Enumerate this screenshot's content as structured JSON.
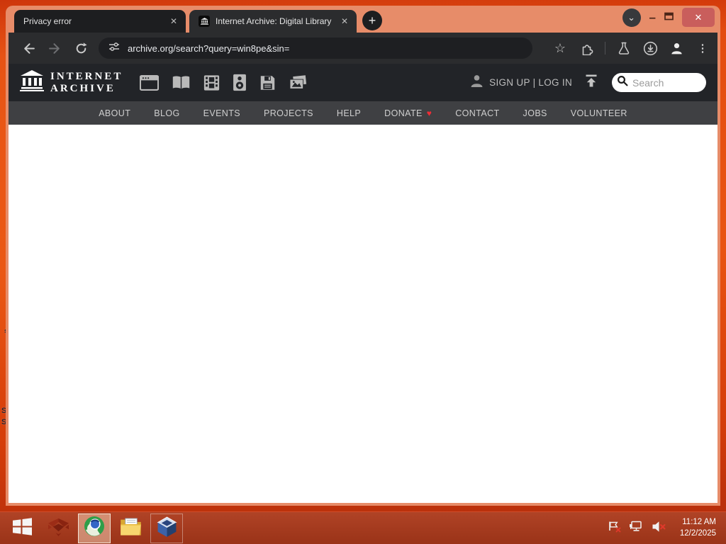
{
  "browser": {
    "tabs": [
      {
        "title": "Privacy error"
      },
      {
        "title": "Internet Archive: Digital Library"
      }
    ],
    "url": "archive.org/search?query=win8pe&sin="
  },
  "glyphs": {
    "close_x": "✕",
    "plus": "+",
    "chevron_down": "⌄",
    "minimize": "–",
    "kebab": "⋮",
    "star": "☆",
    "heart": "♥"
  },
  "ia": {
    "wordmark_line1": "INTERNET",
    "wordmark_line2": "ARCHIVE",
    "auth": "SIGN UP | LOG IN",
    "search_placeholder": "Search",
    "nav": [
      {
        "label": "ABOUT"
      },
      {
        "label": "BLOG"
      },
      {
        "label": "EVENTS"
      },
      {
        "label": "PROJECTS"
      },
      {
        "label": "HELP"
      },
      {
        "label": "DONATE"
      },
      {
        "label": "CONTACT"
      },
      {
        "label": "JOBS"
      },
      {
        "label": "VOLUNTEER"
      }
    ]
  },
  "taskbar": {
    "time": "11:12 AM",
    "date": "12/2/2025"
  },
  "desktop": {
    "fragments": [
      {
        "text": "s"
      },
      {
        "text": "S"
      },
      {
        "text": "S"
      }
    ]
  },
  "colors": {
    "frame_salmon": "#e78c69",
    "desktop_orange": "#e85311",
    "taskbar_red": "#a63a1f",
    "toolbar_dark": "#2b2c2e",
    "ia_header": "#222428",
    "ia_nav": "#3f4043",
    "heart_red": "#ef2d36",
    "close_button_red": "#c95e5c"
  }
}
